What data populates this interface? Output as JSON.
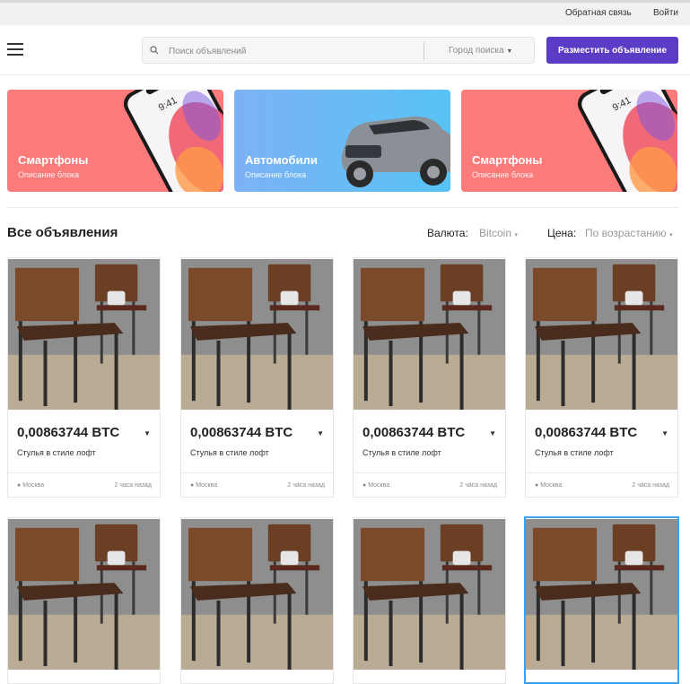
{
  "topbar": {
    "feedback": "Обратная связь",
    "login": "Войти"
  },
  "header": {
    "search_placeholder": "Поиск объявлений",
    "city_label": "Город поиска",
    "post_button": "Разместить объявление"
  },
  "banners": [
    {
      "title": "Смартфоны",
      "desc": "Описание блока",
      "phone_time": "9:41"
    },
    {
      "title": "Автомобили",
      "desc": "Описание блока"
    },
    {
      "title": "Смартфоны",
      "desc": "Описание блока",
      "phone_time": "9:41"
    }
  ],
  "section": {
    "title": "Все объявления",
    "currency_label": "Валюта:",
    "currency_value": "Bitcoin",
    "price_label": "Цена:",
    "price_value": "По возрастанию"
  },
  "listings": [
    {
      "price": "0,00863744 BTC",
      "title": "Стулья в стиле лофт",
      "location": "Москва",
      "time": "2 часа назад"
    },
    {
      "price": "0,00863744 BTC",
      "title": "Стулья в стиле лофт",
      "location": "Москва",
      "time": "2 часа назад"
    },
    {
      "price": "0,00863744 BTC",
      "title": "Стулья в стиле лофт",
      "location": "Москва",
      "time": "2 часа назад"
    },
    {
      "price": "0,00863744 BTC",
      "title": "Стулья в стиле лофт",
      "location": "Москва",
      "time": "2 часа назад"
    },
    {
      "price": "",
      "title": "",
      "location": "",
      "time": ""
    },
    {
      "price": "",
      "title": "",
      "location": "",
      "time": ""
    },
    {
      "price": "",
      "title": "",
      "location": "",
      "time": ""
    },
    {
      "price": "",
      "title": "",
      "location": "",
      "time": ""
    }
  ],
  "colors": {
    "accent": "#5b3cc4",
    "banner_red": "#fb7b7b",
    "banner_blue": "#5fb0f5",
    "selected_border": "#3aa0f0"
  },
  "icons": [
    "menu-icon",
    "search-icon",
    "chevron-down-icon",
    "location-pin-icon"
  ]
}
